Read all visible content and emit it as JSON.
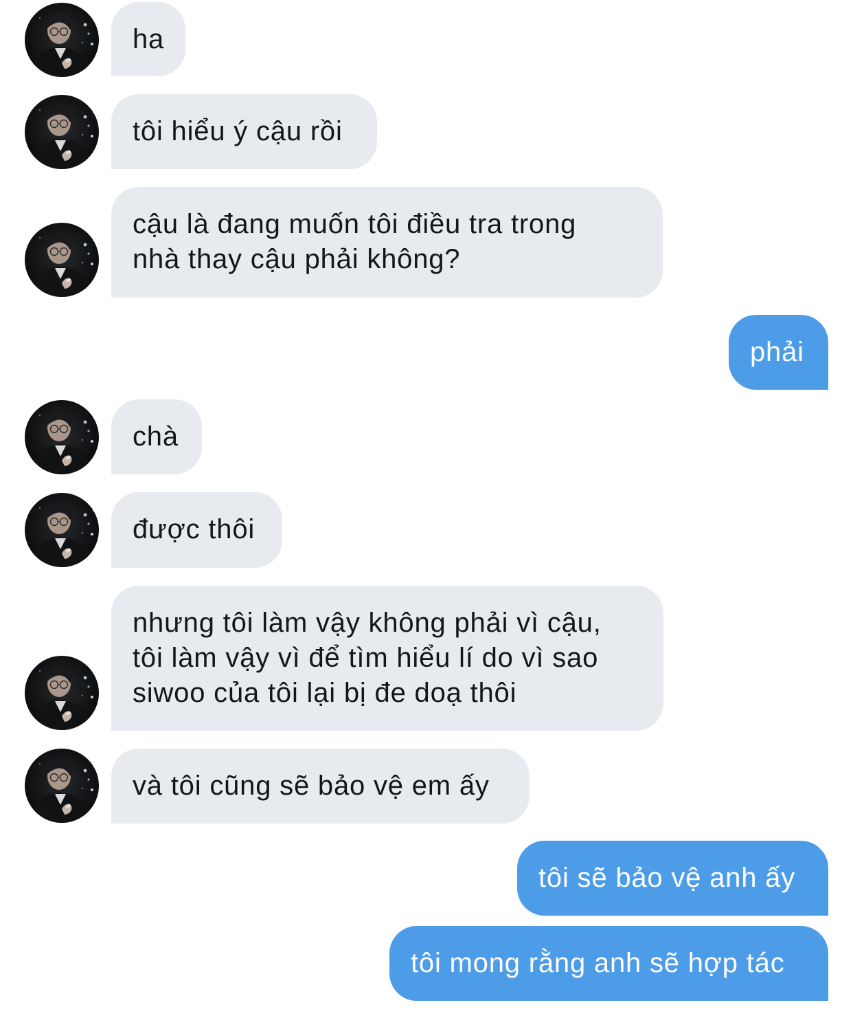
{
  "conversation": {
    "contact_avatar_icon": "contact-avatar",
    "colors": {
      "incoming_bubble": "#e7eaef",
      "incoming_text": "#14171a",
      "outgoing_bubble": "#4c9ce8",
      "outgoing_text": "#ffffff"
    },
    "messages": [
      {
        "direction": "incoming",
        "text": "ha"
      },
      {
        "direction": "incoming",
        "text": "tôi hiểu ý cậu rồi"
      },
      {
        "direction": "incoming",
        "text": "cậu là đang muốn tôi điều tra trong\nnhà thay cậu phải không?"
      },
      {
        "direction": "outgoing",
        "text": "phải"
      },
      {
        "direction": "incoming",
        "text": "chà"
      },
      {
        "direction": "incoming",
        "text": "được thôi"
      },
      {
        "direction": "incoming",
        "text": "nhưng tôi làm vậy không phải vì cậu,\ntôi làm vậy vì để tìm hiểu lí do vì sao\nsiwoo của tôi lại bị đe doạ thôi"
      },
      {
        "direction": "incoming",
        "text": "và tôi cũng sẽ bảo vệ em ấy"
      },
      {
        "direction": "outgoing",
        "text": "tôi sẽ bảo vệ anh ấy"
      },
      {
        "direction": "outgoing",
        "text": "tôi mong rằng anh sẽ hợp tác"
      }
    ]
  }
}
